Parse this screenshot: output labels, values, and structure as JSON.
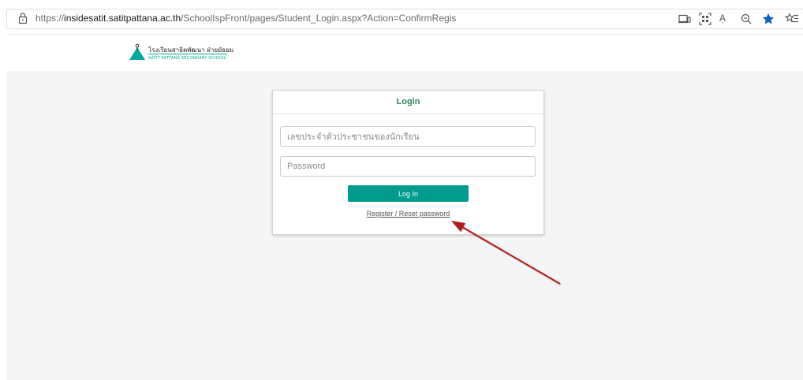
{
  "browser": {
    "url_scheme": "https://",
    "url_host": "insidesatit.satitpattana.ac.th",
    "url_path": "/SchoolIspFront/pages/Student_Login.aspx?Action=ConfirmRegis",
    "read_aloud_label": "Aͅ"
  },
  "school": {
    "name_th": "โรงเรียนสาธิตพัฒนา ฝ่ายมัธยม",
    "name_en": "SATIT PATTANA SECONDARY SCHOOL"
  },
  "login": {
    "title": "Login",
    "id_placeholder": "เลขประจำตัวประชาชนของนักเรียน",
    "password_placeholder": "Password",
    "button_label": "Log In",
    "register_link": "Register / Reset password"
  },
  "colors": {
    "accent": "#009b8f",
    "title": "#2e8b57",
    "annotation_arrow": "#b01e1e",
    "favorite_star": "#0a63c9"
  }
}
